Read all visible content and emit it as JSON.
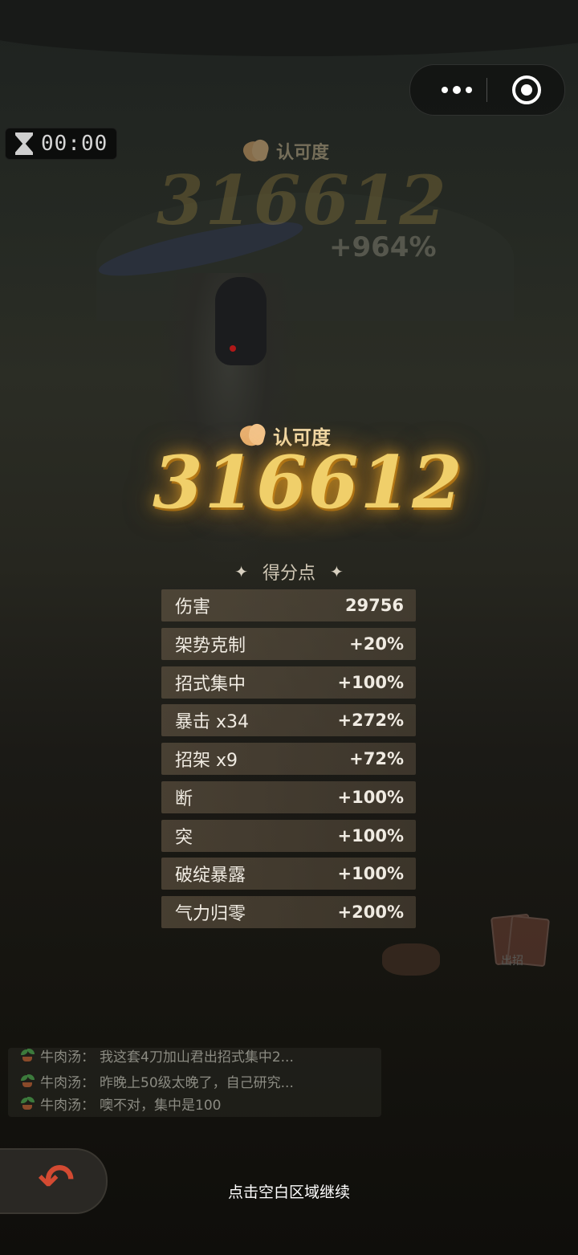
{
  "capsule": {
    "more_icon": "more-dots-icon",
    "close_icon": "target-circle-icon"
  },
  "timer": {
    "icon": "hourglass-icon",
    "time": "00:00"
  },
  "previous_score": {
    "label": "认可度",
    "value": "316612",
    "bonus": "+964%"
  },
  "score": {
    "label": "认可度",
    "value": "316612",
    "color": "#f0cf6a"
  },
  "points": {
    "title": "得分点",
    "rows": [
      {
        "label": "伤害",
        "value": "29756"
      },
      {
        "label": "架势克制",
        "value": "+20%"
      },
      {
        "label": "招式集中",
        "value": "+100%"
      },
      {
        "label": "暴击 x34",
        "value": "+272%"
      },
      {
        "label": "招架 x9",
        "value": "+72%"
      },
      {
        "label": "断",
        "value": "+100%"
      },
      {
        "label": "突",
        "value": "+100%"
      },
      {
        "label": "破绽暴露",
        "value": "+100%"
      },
      {
        "label": "气力归零",
        "value": "+200%"
      }
    ]
  },
  "chat": {
    "lines": [
      {
        "user": "牛肉汤：",
        "text": "我这套4刀加山君出招式集中2..."
      },
      {
        "user": "牛肉汤：",
        "text": "昨晚上50级太晚了，自己研究..."
      },
      {
        "user": "牛肉汤：",
        "text": "噢不对，集中是100"
      }
    ]
  },
  "deco": {
    "cards_label": "出招"
  },
  "footer": {
    "continue_hint": "点击空白区域继续"
  },
  "colors": {
    "accent_gold": "#f0cf6a",
    "back_arrow": "#d34a32"
  }
}
